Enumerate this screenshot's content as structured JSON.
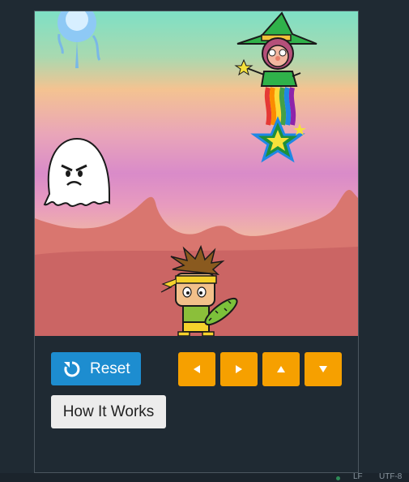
{
  "controls": {
    "reset_label": "Reset",
    "how_it_works_label": "How It Works",
    "arrows": [
      "left",
      "right",
      "up",
      "down"
    ]
  },
  "status_bar": {
    "line_ending": "LF",
    "encoding": "UTF-8"
  },
  "sprites": {
    "top_left": "blue-orb",
    "witch": "green-witch",
    "star": "rainbow-star",
    "ghost": "angry-ghost",
    "player": "ninja-kid-with-cactus"
  },
  "colors": {
    "reset_button": "#1d8dd0",
    "arrow_buttons": "#f6a000",
    "how_button": "#ececec",
    "background": "#1f2a33"
  }
}
